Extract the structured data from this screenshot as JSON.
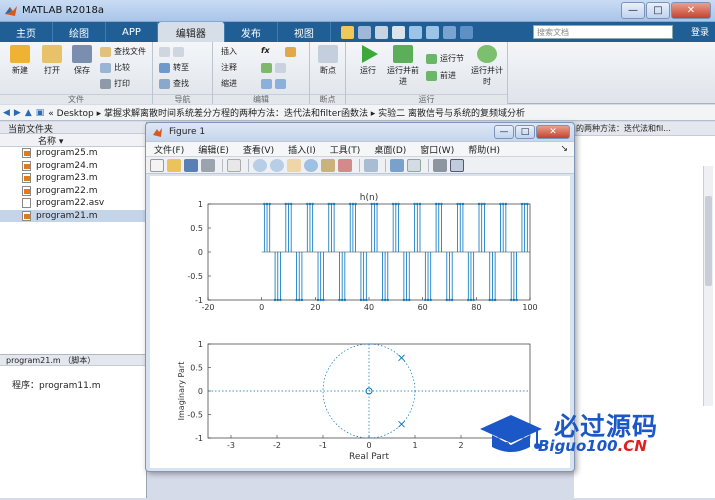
{
  "window": {
    "title": "MATLAB R2018a",
    "min": "—",
    "max": "□",
    "close": "✕"
  },
  "tabs": [
    "主页",
    "绘图",
    "APP",
    "编辑器",
    "发布",
    "视图"
  ],
  "active_tab": "编辑器",
  "search": {
    "placeholder": "搜索文档"
  },
  "login": "登录",
  "ribbon": {
    "file": {
      "label": "文件",
      "new": "新建",
      "open": "打开",
      "save": "保存",
      "find_files": "查找文件",
      "compare": "比较",
      "print": "打印"
    },
    "nav": {
      "label": "导航",
      "goto": "转至",
      "find": "查找"
    },
    "edit": {
      "label": "编辑",
      "insert": "插入",
      "fx": "fx",
      "comment": "注释",
      "indent": "缩进"
    },
    "breakpoints": {
      "label": "断点",
      "breakpoint": "断点"
    },
    "run": {
      "label": "运行",
      "run": "运行",
      "run_advance": "运行并前进",
      "run_section": "运行节",
      "advance": "前进",
      "run_time": "运行并计时"
    }
  },
  "address": {
    "path": "« Desktop ▸ 掌握求解离散时间系统差分方程的两种方法：迭代法和filter函数法 ▸ 实验二 离散信号与系统的复频域分析"
  },
  "current_folder": {
    "header": "当前文件夹",
    "column": "名称 ▾",
    "files": [
      {
        "name": "program25.m",
        "type": "m"
      },
      {
        "name": "program24.m",
        "type": "m"
      },
      {
        "name": "program23.m",
        "type": "m"
      },
      {
        "name": "program22.m",
        "type": "m"
      },
      {
        "name": "program22.asv",
        "type": "asv"
      },
      {
        "name": "program21.m",
        "type": "m",
        "selected": true
      }
    ],
    "detail_header": "program21.m （脚本）",
    "detail_text": "程序：program11.m"
  },
  "right_panel": {
    "header": "的两种方法：迭代法和fil..."
  },
  "figure": {
    "title": "Figure 1",
    "menu": [
      "文件(F)",
      "编辑(E)",
      "查看(V)",
      "插入(I)",
      "工具(T)",
      "桌面(D)",
      "窗口(W)",
      "帮助(H)"
    ]
  },
  "chart_data": [
    {
      "type": "stem",
      "title": "h(n)",
      "xlabel": "",
      "ylabel": "",
      "xlim": [
        -20,
        100
      ],
      "ylim": [
        -1,
        1
      ],
      "xticks": [
        -20,
        0,
        20,
        40,
        60,
        80,
        100
      ],
      "yticks": [
        -1,
        -0.5,
        0,
        0.5,
        1
      ],
      "period": 8,
      "pattern": [
        0,
        1,
        1,
        1,
        0,
        -1,
        -1,
        -1
      ],
      "n_range": [
        0,
        100
      ],
      "color": "#0072BD"
    },
    {
      "type": "pole-zero",
      "title": "",
      "xlabel": "Real Part",
      "ylabel": "Imaginary Part",
      "xlim": [
        -3.5,
        3.5
      ],
      "ylim": [
        -1,
        1
      ],
      "xticks": [
        -3,
        -2,
        -1,
        0,
        1,
        2,
        3
      ],
      "yticks": [
        -1,
        -0.5,
        0,
        0.5,
        1
      ],
      "zeros": [
        [
          0,
          0
        ]
      ],
      "poles": [
        [
          0.7071,
          0.7071
        ],
        [
          0.7071,
          -0.7071
        ]
      ],
      "color": "#0072BD"
    }
  ],
  "watermark": {
    "main": "必过源码",
    "sub": "Biguo100",
    "suffix": ".CN"
  }
}
